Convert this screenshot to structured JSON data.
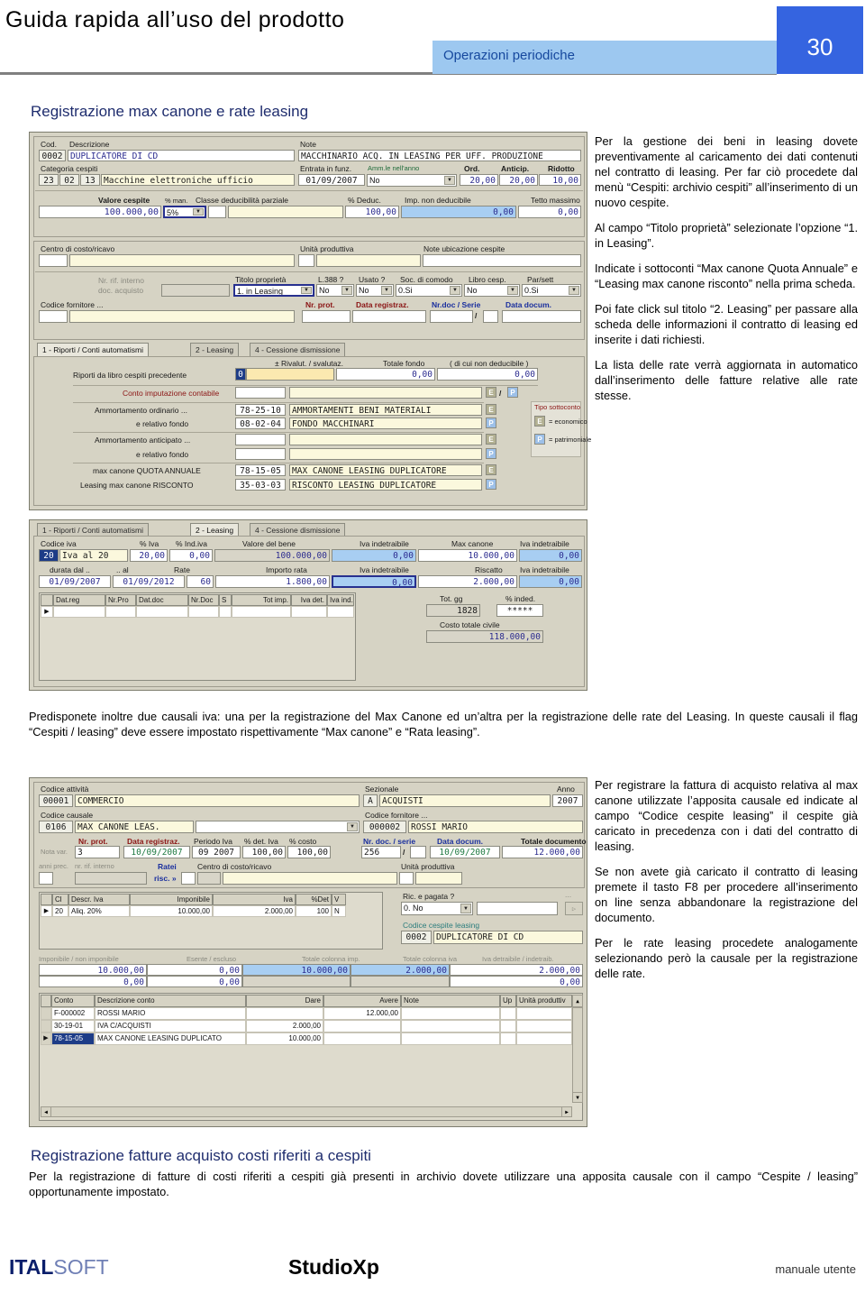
{
  "header": {
    "title": "Guida rapida all’uso del prodotto",
    "section": "Operazioni periodiche",
    "page_number": "30",
    "accent_blue": "#3564e0",
    "section_blue": "#9dc8f0"
  },
  "section_title_1": "Registrazione max canone e rate leasing",
  "section_title_2": "Registrazione fatture acquisto costi riferiti a cespiti",
  "right_column_1": [
    "Per la gestione dei beni in leasing dovete preventivamente al caricamento dei dati contenuti nel contratto di leasing. Per far ciò procedete dal menù “Cespiti: archivio cespiti” all’inserimento di un nuovo cespite.",
    "Al campo “Titolo proprietà” selezionate l’opzione “1. in Leasing”.",
    "Indicate i sottoconti “Max canone Quota Annuale” e “Leasing max canone risconto” nella prima scheda.",
    "Poi fate click sul titolo “2. Leasing” per passare alla scheda delle informazioni il contratto di leasing ed inserite i dati richiesti.",
    "La lista delle rate verrà aggiornata in automatico dall’inserimento delle fatture relative alle rate stesse."
  ],
  "mid_paragraph": "Predisponete inoltre due causali iva: una per la registrazione del Max Canone ed un’altra per la registrazione delle rate del Leasing. In queste causali il flag “Cespiti / leasing” deve essere impostato rispettivamente “Max canone” e “Rata leasing”.",
  "right_column_2": [
    "Per registrare la fattura di acquisto relativa al max canone utilizzate l’apposita causale ed indicate al campo “Codice cespite leasing” il cespite già caricato in precedenza con i dati del contratto di leasing.",
    "Se non avete già caricato il contratto di leasing premete il tasto F8 per procedere all’inserimento on line senza abbandonare la registrazione del documento.",
    "Per le rate leasing procedete analogamente selezionando però la causale per la registrazione delle rate."
  ],
  "bottom_paragraph": "Per la registrazione di fatture di costi riferiti a cespiti già presenti in archivio dovete utilizzare una apposita causale con il campo “Cespite / leasing” opportunamente impostato.",
  "footer": {
    "brand_a": "ITAL",
    "brand_b": "SOFT",
    "product": "StudioXp",
    "right": "manuale utente"
  },
  "shot1": {
    "labels": {
      "cod": "Cod.",
      "descrizione": "Descrizione",
      "note": "Note",
      "categoria_cespiti": "Categoria cespiti",
      "entrata_in_funz": "Entrata in funz.",
      "amm_nellanno": "Amm.le nell'anno",
      "ord": "Ord.",
      "anticip": "Anticip.",
      "ridotto": "Ridotto",
      "valore_cespite": "Valore cespite",
      "pct_man": "% man.",
      "classe_deduc": "Classe deducibilità parziale",
      "pct_deduc": "% Deduc.",
      "imp_non_ded": "Imp. non deducibile",
      "tetto_massimo": "Tetto massimo",
      "centro_costo": "Centro di costo/ricavo",
      "unita_produttiva": "Unità produttiva",
      "note_ubicazione": "Note ubicazione cespite",
      "nr_rif_interno": "Nr. rif. interno",
      "doc_acquisto": "doc. acquisto",
      "titolo_proprieta": "Titolo proprietà",
      "l388": "L.388 ?",
      "usato": "Usato ?",
      "soc_comodo": "Soc. di comodo",
      "libro_cesp": "Libro cesp.",
      "par_sett": "Par/sett",
      "codice_fornitore": "Codice fornitore ...",
      "nr_prot": "Nr. prot.",
      "data_registraz": "Data registraz.",
      "nr_doc_serie": "Nr.doc / Serie",
      "data_docum": "Data docum.",
      "riporti_prec": "Riporti da libro cespiti precedente",
      "rivalut": "± Rivalut. / svalutaz.",
      "totale_fondo": "Totale fondo",
      "di_cui_non_ded": "( di cui non deducibile )",
      "conto_imputazione": "Conto imputazione contabile",
      "amm_ordinario": "Ammortamento ordinario ...",
      "e_relativo_fondo": "e relativo fondo",
      "amm_anticipato": "Ammortamento anticipato ...",
      "max_canone_quota": "max canone QUOTA ANNUALE",
      "leasing_risconto": "Leasing max canone RISCONTO",
      "tipo_sottoconto": "Tipo sottoconto",
      "eq_economico": "= economico",
      "eq_patrimoniale": "= patrimoniale",
      "slash": "/"
    },
    "tabs": [
      "1 - Riporti / Conti automatismi",
      "2 - Leasing",
      "4 - Cessione dismissione"
    ],
    "values": {
      "cod": "0002",
      "descrizione": "DUPLICATORE DI CD",
      "note": "MACCHINARIO ACQ. IN LEASING PER UFF. PRODUZIONE",
      "cat1": "23",
      "cat2": "02",
      "cat3": "13",
      "cat_desc": "Macchine elettroniche ufficio",
      "entrata_in_funz": "01/09/2007",
      "amm_nellanno": "No",
      "ord": "20,00",
      "anticip": "20,00",
      "ridotto": "10,00",
      "valore_cespite": "100.000,00",
      "pct_man": "5%",
      "classe_key": "",
      "classe_desc": "",
      "pct_deduc": "100,00",
      "imp_non_ded": "0,00",
      "tetto_massimo": "0,00",
      "titolo_proprieta": "1. in Leasing",
      "l388": "No",
      "usato": "No",
      "soc_comodo": "0.Si",
      "libro_cesp": "No",
      "par_sett": "0.Si",
      "rivalut": "0",
      "totale_fondo": "0,00",
      "di_cui_non_ded": "0,00",
      "amm_ord_code": "78-25-10",
      "amm_ord_desc": "AMMORTAMENTI BENI MATERIALI",
      "fondo_ord_code": "08-02-04",
      "fondo_ord_desc": "FONDO MACCHINARI",
      "amm_ant_code": "",
      "amm_ant_desc": "",
      "fondo_ant_code": "",
      "fondo_ant_desc": "",
      "max_canone_code": "78-15-05",
      "max_canone_desc": "MAX CANONE LEASING DUPLICATORE",
      "risconto_code": "35-03-03",
      "risconto_desc": "RISCONTO LEASING DUPLICATORE",
      "sub_e": "E",
      "sub_p": "P"
    }
  },
  "shot2": {
    "tabs": [
      "1 - Riporti / Conti automatismi",
      "2 - Leasing",
      "4 - Cessione dismissione"
    ],
    "labels": {
      "codice_iva": "Codice iva",
      "pct_iva": "% Iva",
      "pct_ind_iva": "% Ind.iva",
      "valore_bene": "Valore del bene",
      "iva_indetraibile": "Iva indetraibile",
      "max_canone": "Max canone",
      "durata_dal": "durata dal ..",
      "durata_al": ".. al",
      "rate": "Rate",
      "importo_rata": "Importo rata",
      "riscatto": "Riscatto",
      "tot_gg": "Tot. gg",
      "pct_inded": "% inded.",
      "costo_totale_civile": "Costo totale civile"
    },
    "values": {
      "codice_iva_key": "20",
      "codice_iva_desc": "Iva al 20",
      "pct_iva": "20,00",
      "pct_ind_iva": "0,00",
      "valore_bene": "100.000,00",
      "iva_ind_bene": "0,00",
      "max_canone": "10.000,00",
      "iva_ind_max": "0,00",
      "durata_dal": "01/09/2007",
      "durata_al": "01/09/2012",
      "rate": "60",
      "importo_rata": "1.800,00",
      "iva_ind_rata": "0,00",
      "riscatto": "2.000,00",
      "iva_ind_risc": "0,00",
      "tot_gg": "1828",
      "pct_inded": "*****",
      "costo_totale_civile": "118.000,00"
    },
    "grid_headers": [
      "",
      "Dat.reg",
      "Nr.Pro",
      "Dat.doc",
      "Nr.Doc",
      "S",
      "Tot imp.",
      "Iva det.",
      "Iva ind."
    ],
    "grid_rows": [
      [
        "▶",
        "",
        "",
        "",
        "",
        "",
        "",
        "",
        ""
      ]
    ]
  },
  "shot3": {
    "labels": {
      "codice_attivita": "Codice attività",
      "sezionale": "Sezionale",
      "anno": "Anno",
      "codice_causale": "Codice causale",
      "codice_fornitore": "Codice fornitore ...",
      "nr_prot": "Nr. prot.",
      "data_registraz": "Data registraz.",
      "periodo_iva": "Periodo Iva",
      "pct_det_iva": "% det. Iva",
      "pct_costo": "% costo",
      "nr_doc_serie": "Nr. doc. / serie",
      "data_docum": "Data docum.",
      "totale_documento": "Totale documento",
      "nota_var": "Nota var.",
      "anni_prec": "anni prec.",
      "nr_rif_interno": "nr. rif. interno",
      "ratei": "Ratei",
      "risc": "risc. »",
      "centro_costo": "Centro di costo/ricavo",
      "unita_produttiva": "Unità produttiva",
      "ric_pagata": "Ric. e pagata ?",
      "codice_cespite_leasing": "Codice cespite leasing",
      "imponibile_non": "Imponibile / non imponibile",
      "esente_escluso": "Esente / escluso",
      "tot_col_imp": "Totale colonna imp.",
      "tot_col_iva": "Totale colonna iva",
      "iva_det_indet": "Iva detraibile / indetraib.",
      "slash": "/",
      "dots": "..."
    },
    "values": {
      "codice_attivita_key": "00001",
      "codice_attivita_desc": "COMMERCIO",
      "sezionale_key": "A",
      "sezionale_desc": "ACQUISTI",
      "anno": "2007",
      "codice_causale_key": "0106",
      "codice_causale_desc": "MAX CANONE LEAS.",
      "causale_extra": "",
      "fornitore_key": "000002",
      "fornitore_desc": "ROSSI MARIO",
      "nota_var": "3",
      "data_registraz": "10/09/2007",
      "periodo_iva": "09 2007",
      "pct_det_iva": "100,00",
      "pct_costo": "100,00",
      "nr_doc": "256",
      "serie": "",
      "data_docum": "10/09/2007",
      "totale_documento": "12.000,00",
      "ric_pagata": "0. No",
      "cespite_key": "0002",
      "cespite_desc": "DUPLICATORE DI CD",
      "tot_imponibile": "10.000,00",
      "tot_esente": "0,00",
      "tot_col_imp": "10.000,00",
      "tot_col_iva": "2.000,00",
      "tot_iva_det": "2.000,00",
      "row2_imponibile": "0,00",
      "row2_esente": "0,00",
      "row2_iva_det": "0,00"
    },
    "iva_grid_headers": [
      "",
      "Cl",
      "Descr. Iva",
      "Imponibile",
      "Iva",
      "%Det",
      "V"
    ],
    "iva_grid_rows": [
      [
        "▶",
        "20",
        "Aliq. 20%",
        "10.000,00",
        "2.000,00",
        "100",
        "N"
      ]
    ],
    "conto_grid_headers": [
      "",
      "Conto",
      "Descrizione conto",
      "Dare",
      "Avere",
      "Note",
      "Up",
      "Unità produttiv"
    ],
    "conto_grid_rows": [
      [
        "",
        "F-000002",
        "ROSSI MARIO",
        "",
        "12.000,00",
        "",
        "",
        ""
      ],
      [
        "",
        "30-19-01",
        "IVA C/ACQUISTI",
        "2.000,00",
        "",
        "",
        "",
        ""
      ],
      [
        "▶",
        "78-15-05",
        "MAX CANONE LEASING DUPLICATO",
        "10.000,00",
        "",
        "",
        "",
        ""
      ]
    ]
  }
}
